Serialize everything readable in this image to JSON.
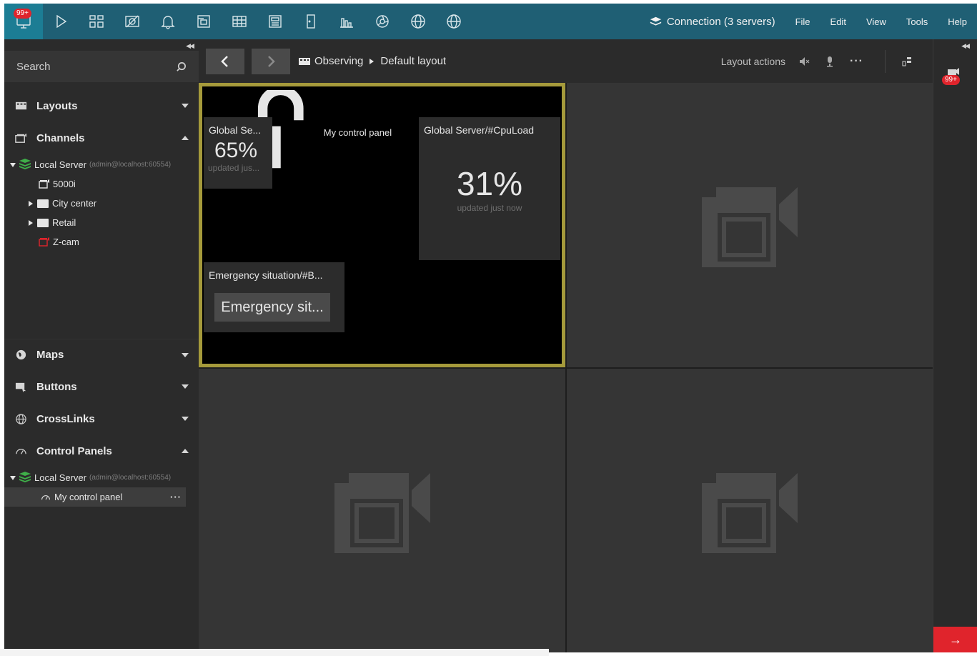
{
  "topbar": {
    "badge": "99+",
    "icons": [
      "monitor-icon",
      "play-icon",
      "layout-grid-icon",
      "no-camera-icon",
      "bell-icon",
      "archive-icon",
      "table-icon",
      "calendar-grid-icon",
      "door-icon",
      "bar-chart-icon",
      "aperture-icon",
      "www-globe-icon",
      "www-globe-icon-2"
    ],
    "connection": "Connection (3 servers)",
    "menu": [
      "File",
      "Edit",
      "View",
      "Tools",
      "Help"
    ]
  },
  "sidebar": {
    "search_placeholder": "Search",
    "sections": {
      "layouts": "Layouts",
      "channels": "Channels",
      "maps": "Maps",
      "buttons": "Buttons",
      "crosslinks": "CrossLinks",
      "control_panels": "Control Panels"
    },
    "channels_tree": {
      "server": "Local Server",
      "server_sub": "(admin@localhost:60554)",
      "items": [
        "5000i",
        "City center",
        "Retail",
        "Z-cam"
      ]
    },
    "panels_tree": {
      "server": "Local Server",
      "server_sub": "(admin@localhost:60554)",
      "item": "My control panel"
    }
  },
  "navbar": {
    "crumb1": "Observing",
    "crumb2": "Default layout",
    "layout_actions": "Layout actions",
    "more": "···"
  },
  "rail": {
    "badge": "99+",
    "arrow": "→"
  },
  "panel": {
    "title": "My control panel",
    "tile1": {
      "title": "Global Se...",
      "value": "65%",
      "updated": "updated jus..."
    },
    "tile2": {
      "title": "Global Server/#CpuLoad",
      "value": "31%",
      "updated": "updated just now"
    },
    "tile3": {
      "title": "Emergency situation/#B...",
      "button": "Emergency sit..."
    }
  },
  "colors": {
    "topbar": "#1f5f74",
    "accent_border": "#a59a3b",
    "server_green": "#3fae49",
    "alert_red": "#e0242c"
  }
}
